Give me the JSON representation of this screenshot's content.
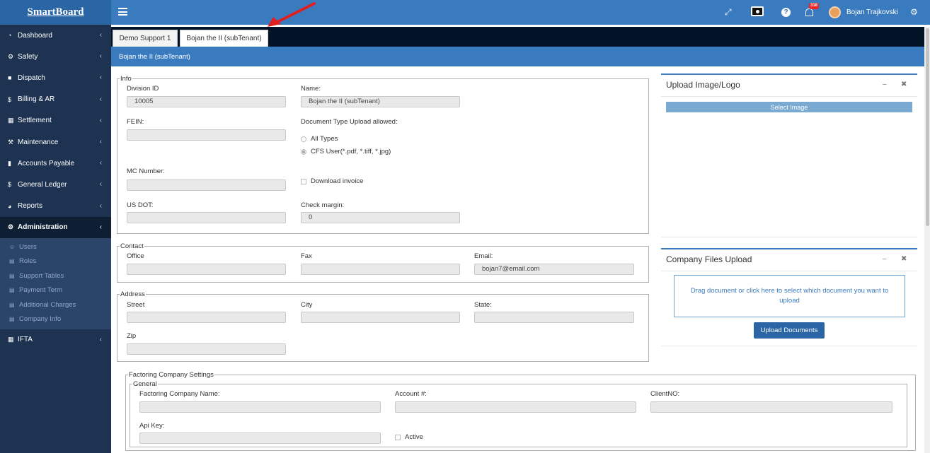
{
  "app": {
    "brand": "SmartBoard",
    "user_name": "Bojan Trajkovski",
    "notification_count": "318"
  },
  "sidebar": {
    "items": [
      {
        "label": "Dashboard",
        "icon": "dashboard-icon"
      },
      {
        "label": "Safety",
        "icon": "cogs-icon"
      },
      {
        "label": "Dispatch",
        "icon": "truck-icon"
      },
      {
        "label": "Billing & AR",
        "icon": "dollar-icon"
      },
      {
        "label": "Settlement",
        "icon": "calculator-icon"
      },
      {
        "label": "Maintenance",
        "icon": "wrench-icon"
      },
      {
        "label": "Accounts Payable",
        "icon": "book-icon"
      },
      {
        "label": "General Ledger",
        "icon": "dollar-icon"
      },
      {
        "label": "Reports",
        "icon": "pie-chart-icon"
      },
      {
        "label": "Administration",
        "icon": "cogs-icon"
      }
    ],
    "admin_subitems": [
      {
        "label": "Users",
        "icon": "users-icon"
      },
      {
        "label": "Roles",
        "icon": "table-icon"
      },
      {
        "label": "Support Tables",
        "icon": "table-icon"
      },
      {
        "label": "Payment Term",
        "icon": "table-icon"
      },
      {
        "label": "Additional Charges",
        "icon": "table-icon"
      },
      {
        "label": "Company Info",
        "icon": "table-icon"
      }
    ],
    "last_item": {
      "label": "IFTA",
      "icon": "calculator-icon"
    }
  },
  "tabs": [
    {
      "label": "Demo Support 1"
    },
    {
      "label": "Bojan the II (subTenant)"
    }
  ],
  "page_header": "Bojan the II (subTenant)",
  "info": {
    "legend": "Info",
    "division_id_label": "Division ID",
    "division_id_value": "10005",
    "name_label": "Name:",
    "name_value": "Bojan the II (subTenant)",
    "fein_label": "FEIN:",
    "fein_value": "",
    "doc_type_label": "Document Type Upload allowed:",
    "doc_type_options": [
      "All Types",
      "CFS User(*.pdf, *.tiff, *.jpg)"
    ],
    "doc_type_selected": "CFS User(*.pdf, *.tiff, *.jpg)",
    "mc_number_label": "MC Number:",
    "mc_number_value": "",
    "download_invoice_label": "Download invoice",
    "download_invoice_checked": false,
    "us_dot_label": "US DOT:",
    "us_dot_value": "",
    "check_margin_label": "Check margin:",
    "check_margin_value": "0"
  },
  "contact": {
    "legend": "Contact",
    "office_label": "Office",
    "office_value": "",
    "fax_label": "Fax",
    "fax_value": "",
    "email_label": "Email:",
    "email_value": "bojan7@email.com"
  },
  "address": {
    "legend": "Address",
    "street_label": "Street",
    "city_label": "City",
    "state_label": "State:",
    "zip_label": "Zip"
  },
  "factoring": {
    "legend": "Factoring Company Settings",
    "general_legend": "General",
    "company_name_label": "Factoring Company Name:",
    "account_label": "Account #:",
    "client_no_label": "ClientNO:",
    "api_key_label": "Api Key:",
    "active_label": "Active",
    "active_checked": false
  },
  "upload_image_panel": {
    "title": "Upload Image/Logo",
    "select_button": "Select Image"
  },
  "company_files_panel": {
    "title": "Company Files Upload",
    "dropzone_text": "Drag document or click here to select which document you want to upload",
    "upload_button": "Upload Documents"
  },
  "colors": {
    "topbar": "#3a7bbf",
    "sidebar": "#1e3352",
    "tabstrip": "#031327",
    "primary_button": "#2a66a6",
    "annotation_arrow": "#e02020"
  }
}
